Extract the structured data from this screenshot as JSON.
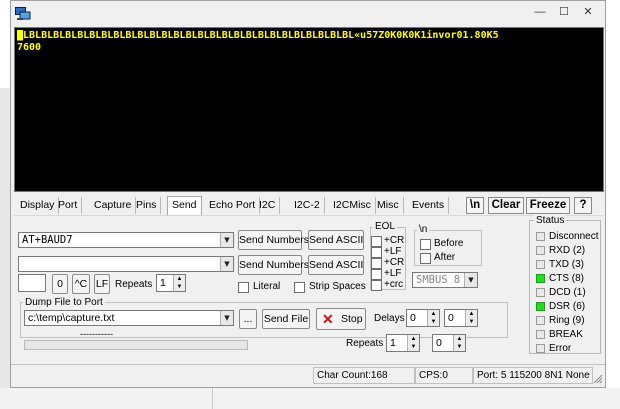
{
  "window": {
    "title_buttons": [
      "—",
      "☐",
      "✕"
    ],
    "app_icon": "terminal-app-icon"
  },
  "terminal": {
    "lines": [
      "█LBLBLBLBLBLBLBLBLBLBLBLBLBLBLBLBLBLBLBLBLBLBLBLBLBLBLBL«u57Z0K0K0K1invor01.80K5",
      "7600"
    ],
    "text_color": "#ffff00",
    "background": "#000000"
  },
  "tabs": [
    {
      "label": "Display",
      "active": false
    },
    {
      "label": "Port",
      "active": false
    },
    {
      "label": "Capture",
      "active": false
    },
    {
      "label": "Pins",
      "active": false
    },
    {
      "label": "Send",
      "active": true
    },
    {
      "label": "Echo Port",
      "active": false
    },
    {
      "label": "I2C",
      "active": false
    },
    {
      "label": "I2C-2",
      "active": false
    },
    {
      "label": "I2CMisc",
      "active": false
    },
    {
      "label": "Misc",
      "active": false
    },
    {
      "label": "Events",
      "active": false
    }
  ],
  "toolbar": {
    "newline_label": "\\n",
    "clear_label": "Clear",
    "freeze_label": "Freeze",
    "help_label": "?"
  },
  "send": {
    "input1_value": "AT+BAUD7",
    "input2_value": "",
    "send_numbers_label": "Send Numbers",
    "send_ascii_label": "Send ASCII",
    "send_numbers2_label": "Send Numbers",
    "send_ascii2_label": "Send ASCII",
    "small_value": "",
    "zero_label": "0",
    "caret_c_label": "^C",
    "lf_label": "LF",
    "repeats_label": "Repeats",
    "repeats_value": "1",
    "literal_label": "Literal",
    "strip_spaces_label": "Strip Spaces",
    "eol_label": "EOL",
    "eol_options": [
      "+CR",
      "+LF",
      "+CR",
      "+LF",
      "+crc"
    ],
    "newline_group_label": "\\n",
    "before_label": "Before",
    "after_label": "After",
    "smbus_value": "SMBUS 8"
  },
  "dump": {
    "group_label": "Dump File to Port",
    "path": "c:\\temp\\capture.txt",
    "browse_label": "...",
    "send_file_label": "Send File",
    "stop_label": "Stop",
    "progress_text": "-----------",
    "delays_label": "Delays",
    "delay1": "0",
    "delay2": "0",
    "repeats_label": "Repeats",
    "repeats1": "1",
    "repeats2": "0"
  },
  "status": {
    "group_label": "Status",
    "items": [
      {
        "label": "Disconnect",
        "on": false
      },
      {
        "label": "RXD (2)",
        "on": false
      },
      {
        "label": "TXD (3)",
        "on": false
      },
      {
        "label": "CTS (8)",
        "on": true
      },
      {
        "label": "DCD (1)",
        "on": false
      },
      {
        "label": "DSR (6)",
        "on": true
      },
      {
        "label": "Ring (9)",
        "on": false
      },
      {
        "label": "BREAK",
        "on": false
      },
      {
        "label": "Error",
        "on": false
      }
    ],
    "led_on_color": "#1ee01e"
  },
  "statusbar": {
    "char_count": "Char Count:168",
    "cps": "CPS:0",
    "port": "Port: 5  115200 8N1 None"
  }
}
